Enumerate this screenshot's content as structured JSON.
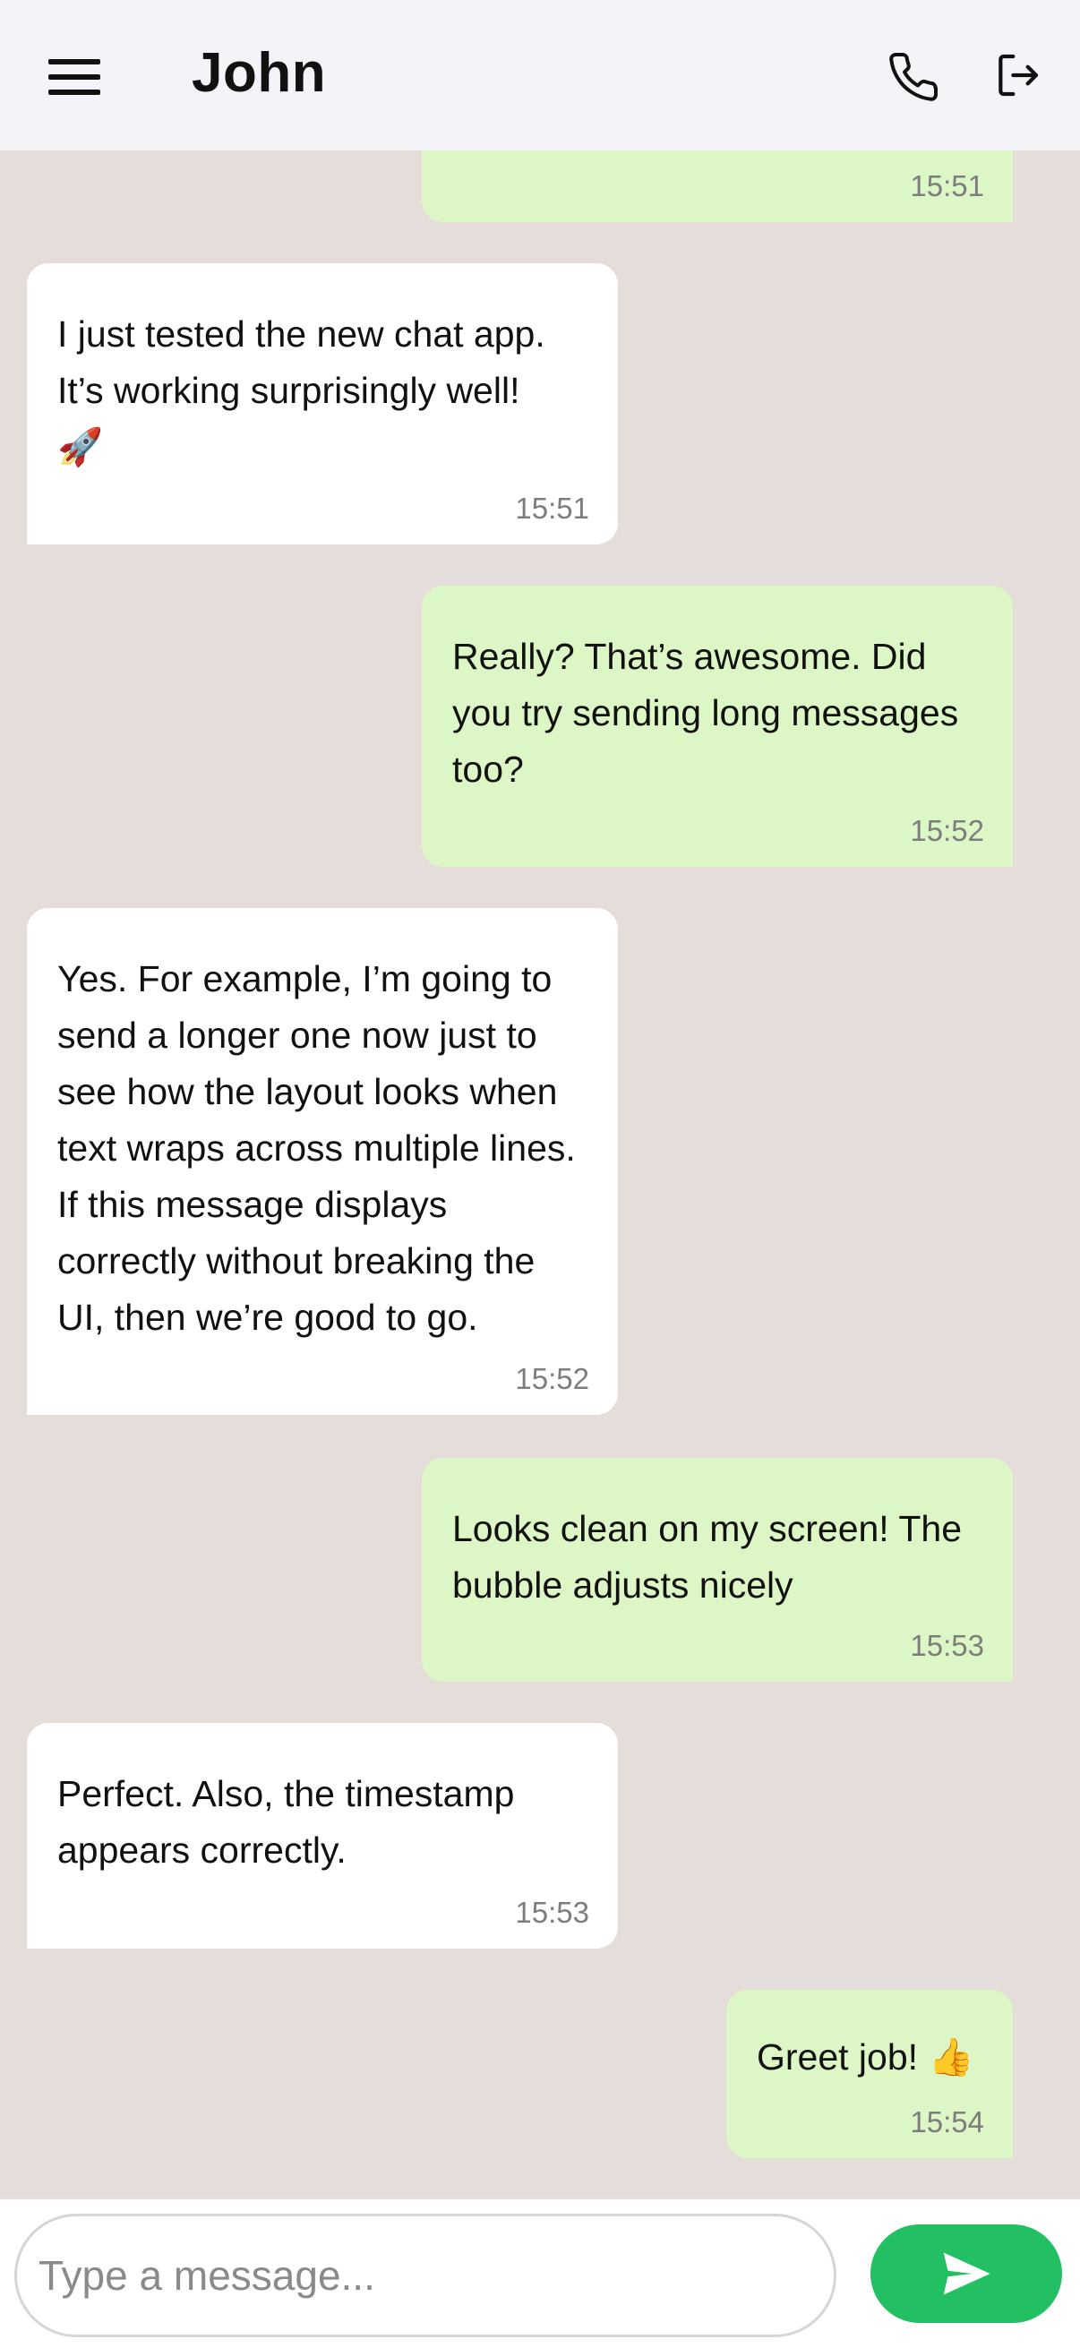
{
  "header": {
    "title": "John"
  },
  "input": {
    "placeholder": "Type a message..."
  },
  "messages": [
    {
      "direction": "out",
      "text": "",
      "time": "15:51"
    },
    {
      "direction": "in",
      "text": "I just tested the new chat app. It’s working surprisingly well!",
      "emoji": "🚀",
      "time": "15:51"
    },
    {
      "direction": "out",
      "text": "Really? That’s awesome. Did you try sending long messages too?",
      "time": "15:52"
    },
    {
      "direction": "in",
      "text": "Yes. For example, I’m going to send a longer one now just to see how the layout looks when text wraps across multiple lines. If this message displays correctly without breaking the UI, then we’re good to go.",
      "time": "15:52"
    },
    {
      "direction": "out",
      "text": "Looks clean on my screen! The bubble adjusts nicely",
      "time": "15:53"
    },
    {
      "direction": "in",
      "text": "Perfect. Also, the timestamp appears correctly.",
      "time": "15:53"
    },
    {
      "direction": "out",
      "text": "Greet job!",
      "emoji": "👍",
      "time": "15:54"
    }
  ],
  "colors": {
    "background": "#e5ddda",
    "incoming_bubble": "#ffffff",
    "outgoing_bubble": "#dcf7c5",
    "send_button": "#22c063",
    "header": "#f2f4f8"
  },
  "icons": {
    "menu": "hamburger-menu-icon",
    "call": "phone-icon",
    "logout": "logout-icon",
    "send": "send-arrow-icon"
  }
}
